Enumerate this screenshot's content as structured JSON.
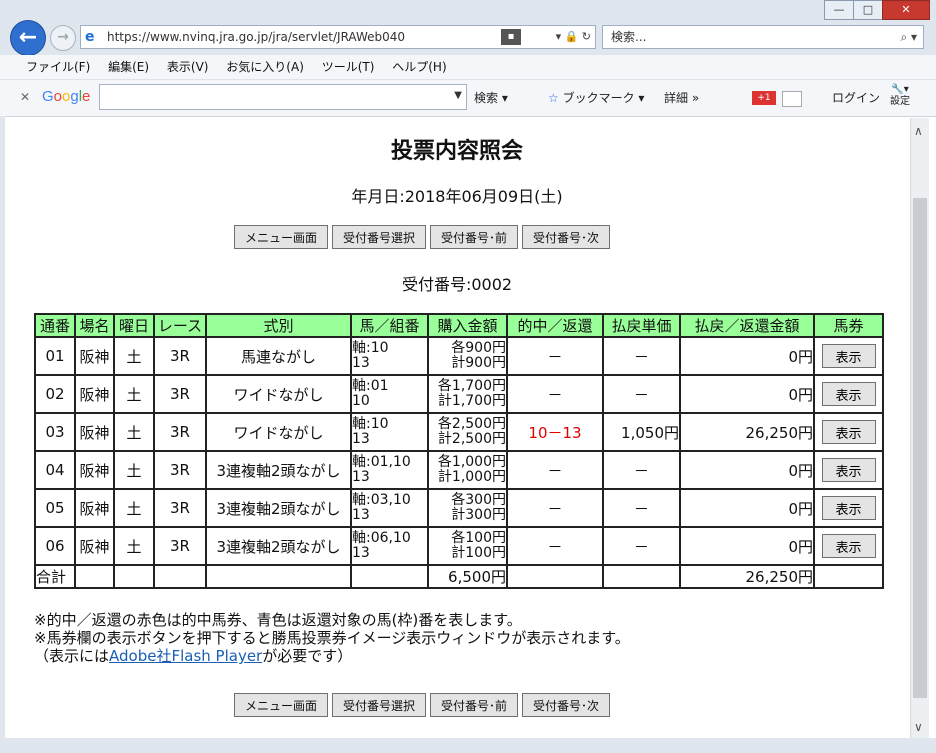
{
  "browser": {
    "url": "https://www.nvinq.jra.go.jp/jra/servlet/JRAWeb040",
    "search_placeholder": "検索...",
    "window_buttons": [
      "—",
      "□",
      "✕"
    ],
    "menu": [
      "ファイル(F)",
      "編集(E)",
      "表示(V)",
      "お気に入り(A)",
      "ツール(T)",
      "ヘルプ(H)"
    ],
    "google_toolbar": {
      "logo": "Google",
      "search_label": "検索",
      "bookmark_label": "ブックマーク",
      "more_label": "詳細 »",
      "plus_label": "+1",
      "login_label": "ログイン",
      "settings_label": "設定"
    }
  },
  "page": {
    "title": "投票内容照会",
    "date_line": "年月日:2018年06月09日(土)",
    "receipt_line": "受付番号:0002",
    "nav_buttons": [
      "メニュー画面",
      "受付番号選択",
      "受付番号･前",
      "受付番号･次"
    ]
  },
  "table": {
    "headers": [
      "通番",
      "場名",
      "曜日",
      "レース",
      "式別",
      "馬／組番",
      "購入金額",
      "的中／返還",
      "払戻単価",
      "払戻／返還金額",
      "馬券"
    ],
    "rows": [
      {
        "no": "01",
        "venue": "阪神",
        "day": "土",
        "race": "3R",
        "type": "馬連ながし",
        "horse1": "軸:10",
        "horse2": "13",
        "each": "各900円",
        "total": "計900円",
        "hit": "－",
        "unit": "－",
        "payout": "0円",
        "btn": "表示"
      },
      {
        "no": "02",
        "venue": "阪神",
        "day": "土",
        "race": "3R",
        "type": "ワイドながし",
        "horse1": "軸:01",
        "horse2": "10",
        "each": "各1,700円",
        "total": "計1,700円",
        "hit": "－",
        "unit": "－",
        "payout": "0円",
        "btn": "表示"
      },
      {
        "no": "03",
        "venue": "阪神",
        "day": "土",
        "race": "3R",
        "type": "ワイドながし",
        "horse1": "軸:10",
        "horse2": "13",
        "each": "各2,500円",
        "total": "計2,500円",
        "hit": "10－13",
        "unit": "1,050円",
        "payout": "26,250円",
        "btn": "表示"
      },
      {
        "no": "04",
        "venue": "阪神",
        "day": "土",
        "race": "3R",
        "type": "3連複軸2頭ながし",
        "horse1": "軸:01,10",
        "horse2": "13",
        "each": "各1,000円",
        "total": "計1,000円",
        "hit": "－",
        "unit": "－",
        "payout": "0円",
        "btn": "表示"
      },
      {
        "no": "05",
        "venue": "阪神",
        "day": "土",
        "race": "3R",
        "type": "3連複軸2頭ながし",
        "horse1": "軸:03,10",
        "horse2": "13",
        "each": "各300円",
        "total": "計300円",
        "hit": "－",
        "unit": "－",
        "payout": "0円",
        "btn": "表示"
      },
      {
        "no": "06",
        "venue": "阪神",
        "day": "土",
        "race": "3R",
        "type": "3連複軸2頭ながし",
        "horse1": "軸:06,10",
        "horse2": "13",
        "each": "各100円",
        "total": "計100円",
        "hit": "－",
        "unit": "－",
        "payout": "0円",
        "btn": "表示"
      }
    ],
    "total_row": {
      "label": "合計",
      "purchase": "6,500円",
      "payout": "26,250円"
    }
  },
  "notes": {
    "line1": "※的中／返還の赤色は的中馬券、青色は返還対象の馬(枠)番を表します。",
    "line2": "※馬券欄の表示ボタンを押下すると勝馬投票券イメージ表示ウィンドウが表示されます。",
    "line3_pre": "（表示には",
    "line3_link": "Adobe社Flash Player",
    "line3_post": "が必要です）"
  },
  "colors": {
    "header_bg": "#99ff99",
    "hit_red": "#e00000",
    "link": "#1a5fb4"
  }
}
